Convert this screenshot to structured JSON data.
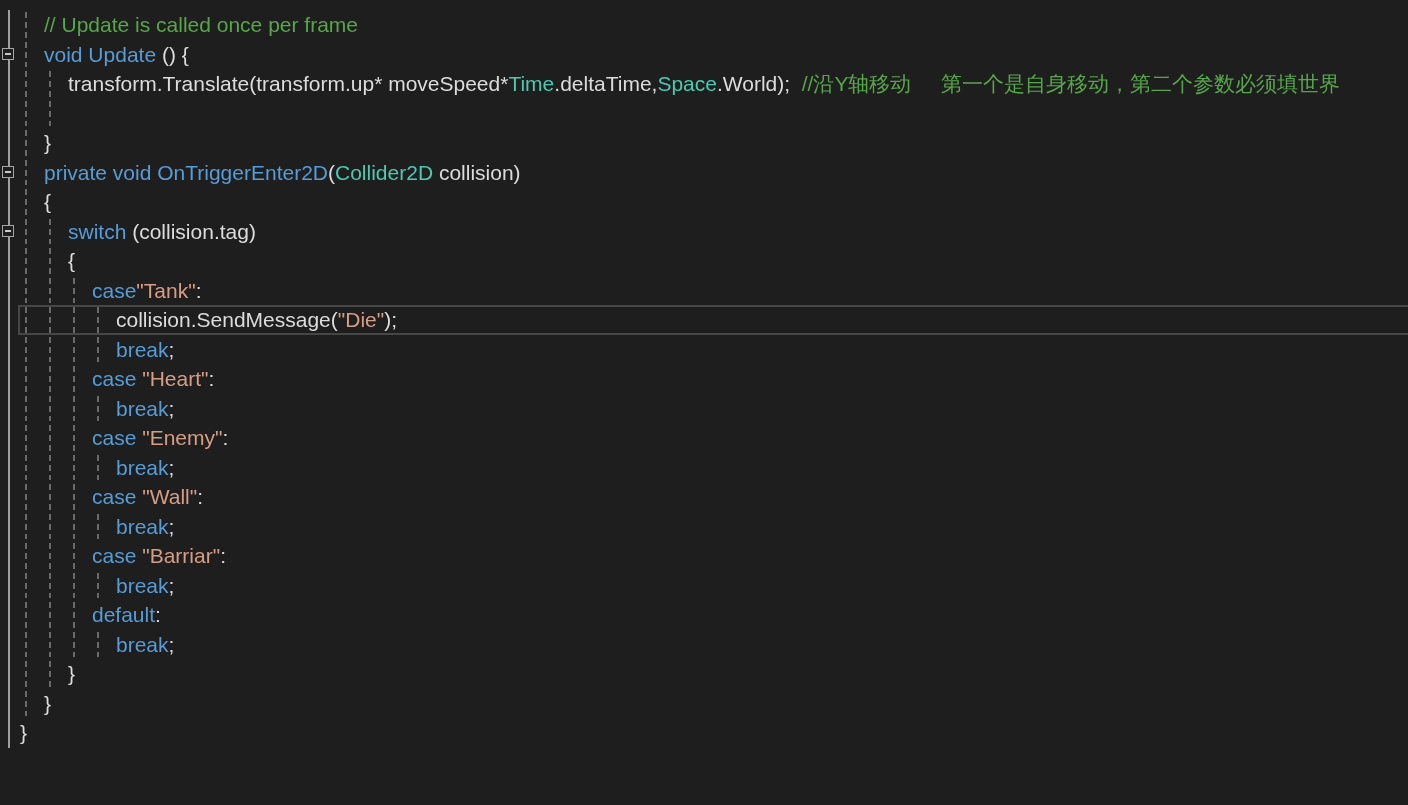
{
  "editor": {
    "lines": [
      {
        "children": [
          {
            "fold_box": false,
            "current": false,
            "tokens": [
              {
                "kind": "comment",
                "text": "// Update is called once per frame"
              }
            ]
          },
          {
            "fold_box": true,
            "current": false,
            "tokens": [
              {
                "kind": "keyword",
                "text": "void Update"
              },
              {
                "kind": "plain",
                "text": " () {"
              }
            ],
            "children": [
              {
                "fold_box": false,
                "current": false,
                "tokens": [
                  {
                    "kind": "plain",
                    "text": "transform.Translate(transform.up* moveSpeed*"
                  },
                  {
                    "kind": "type",
                    "text": "Time"
                  },
                  {
                    "kind": "plain",
                    "text": ".deltaTime,"
                  },
                  {
                    "kind": "type",
                    "text": "Space"
                  },
                  {
                    "kind": "plain",
                    "text": ".World);  "
                  },
                  {
                    "kind": "comment",
                    "text": "//沿Y轴移动     第一个是自身移动，第二个参数必须填世界"
                  }
                ]
              },
              {
                "fold_box": false,
                "current": false
              }
            ]
          },
          {
            "fold_box": false,
            "current": false,
            "tokens": [
              {
                "kind": "plain",
                "text": "}"
              }
            ]
          },
          {
            "fold_box": true,
            "current": false,
            "tokens": [
              {
                "kind": "keyword",
                "text": "private void OnTriggerEnter2D"
              },
              {
                "kind": "plain",
                "text": "("
              },
              {
                "kind": "type",
                "text": "Collider2D"
              },
              {
                "kind": "plain",
                "text": " collision)"
              }
            ]
          },
          {
            "fold_box": false,
            "current": false,
            "tokens": [
              {
                "kind": "plain",
                "text": "{"
              }
            ],
            "children": [
              {
                "fold_box": true,
                "current": false,
                "tokens": [
                  {
                    "kind": "keyword",
                    "text": "switch"
                  },
                  {
                    "kind": "plain",
                    "text": " (collision.tag)"
                  }
                ]
              },
              {
                "fold_box": false,
                "current": false,
                "tokens": [
                  {
                    "kind": "plain",
                    "text": "{"
                  }
                ],
                "children": [
                  {
                    "fold_box": false,
                    "current": false,
                    "tokens": [
                      {
                        "kind": "keyword",
                        "text": "case"
                      },
                      {
                        "kind": "string",
                        "text": "\"Tank\""
                      },
                      {
                        "kind": "plain",
                        "text": ":"
                      }
                    ],
                    "children": [
                      {
                        "fold_box": false,
                        "current": true,
                        "tokens": [
                          {
                            "kind": "plain",
                            "text": "collision.SendMessage("
                          },
                          {
                            "kind": "string",
                            "text": "\"Die\""
                          },
                          {
                            "kind": "plain",
                            "text": ");"
                          }
                        ]
                      },
                      {
                        "fold_box": false,
                        "current": false,
                        "tokens": [
                          {
                            "kind": "keyword",
                            "text": "break"
                          },
                          {
                            "kind": "plain",
                            "text": ";"
                          }
                        ]
                      }
                    ]
                  },
                  {
                    "fold_box": false,
                    "current": false,
                    "tokens": [
                      {
                        "kind": "keyword",
                        "text": "case "
                      },
                      {
                        "kind": "string",
                        "text": "\"Heart\""
                      },
                      {
                        "kind": "plain",
                        "text": ":"
                      }
                    ],
                    "children": [
                      {
                        "fold_box": false,
                        "current": false,
                        "tokens": [
                          {
                            "kind": "keyword",
                            "text": "break"
                          },
                          {
                            "kind": "plain",
                            "text": ";"
                          }
                        ]
                      }
                    ]
                  },
                  {
                    "fold_box": false,
                    "current": false,
                    "tokens": [
                      {
                        "kind": "keyword",
                        "text": "case "
                      },
                      {
                        "kind": "string",
                        "text": "\"Enemy\""
                      },
                      {
                        "kind": "plain",
                        "text": ":"
                      }
                    ],
                    "children": [
                      {
                        "fold_box": false,
                        "current": false,
                        "tokens": [
                          {
                            "kind": "keyword",
                            "text": "break"
                          },
                          {
                            "kind": "plain",
                            "text": ";"
                          }
                        ]
                      }
                    ]
                  },
                  {
                    "fold_box": false,
                    "current": false,
                    "tokens": [
                      {
                        "kind": "keyword",
                        "text": "case "
                      },
                      {
                        "kind": "string",
                        "text": "\"Wall\""
                      },
                      {
                        "kind": "plain",
                        "text": ":"
                      }
                    ],
                    "children": [
                      {
                        "fold_box": false,
                        "current": false,
                        "tokens": [
                          {
                            "kind": "keyword",
                            "text": "break"
                          },
                          {
                            "kind": "plain",
                            "text": ";"
                          }
                        ]
                      }
                    ]
                  },
                  {
                    "fold_box": false,
                    "current": false,
                    "tokens": [
                      {
                        "kind": "keyword",
                        "text": "case "
                      },
                      {
                        "kind": "string",
                        "text": "\"Barriar\""
                      },
                      {
                        "kind": "plain",
                        "text": ":"
                      }
                    ],
                    "children": [
                      {
                        "fold_box": false,
                        "current": false,
                        "tokens": [
                          {
                            "kind": "keyword",
                            "text": "break"
                          },
                          {
                            "kind": "plain",
                            "text": ";"
                          }
                        ]
                      }
                    ]
                  },
                  {
                    "fold_box": false,
                    "current": false,
                    "tokens": [
                      {
                        "kind": "keyword",
                        "text": "default"
                      },
                      {
                        "kind": "plain",
                        "text": ":"
                      }
                    ],
                    "children": [
                      {
                        "fold_box": false,
                        "current": false,
                        "tokens": [
                          {
                            "kind": "keyword",
                            "text": "break"
                          },
                          {
                            "kind": "plain",
                            "text": ";"
                          }
                        ]
                      }
                    ]
                  }
                ]
              },
              {
                "fold_box": false,
                "current": false,
                "tokens": [
                  {
                    "kind": "plain",
                    "text": "}"
                  }
                ]
              }
            ]
          },
          {
            "fold_box": false,
            "current": false,
            "tokens": [
              {
                "kind": "plain",
                "text": "}"
              }
            ]
          }
        ]
      },
      {
        "fold_box": false,
        "current": false,
        "tokens": [
          {
            "kind": "plain",
            "text": "}"
          }
        ]
      }
    ]
  }
}
